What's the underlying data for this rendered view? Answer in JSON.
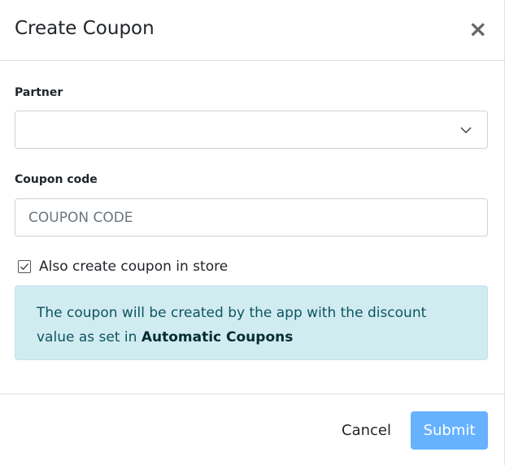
{
  "modal": {
    "title": "Create Coupon",
    "close_symbol": "×"
  },
  "form": {
    "partner": {
      "label": "Partner",
      "selected_value": ""
    },
    "coupon_code": {
      "label": "Coupon code",
      "value": "",
      "placeholder": "COUPON CODE"
    },
    "also_create": {
      "label": "Also create coupon in store",
      "checked": true
    },
    "info": {
      "text_before": "The coupon will be created by the app with the discount value as set in ",
      "bold_text": "Automatic Coupons"
    }
  },
  "footer": {
    "cancel_label": "Cancel",
    "submit_label": "Submit"
  },
  "colors": {
    "submit_bg": "#66b2ff",
    "info_bg": "#d1ecf1",
    "info_text": "#0c5460"
  },
  "icons": {
    "close": "close-icon",
    "select": "chevron-down-icon",
    "checkbox": "checkbox-checked-icon"
  }
}
